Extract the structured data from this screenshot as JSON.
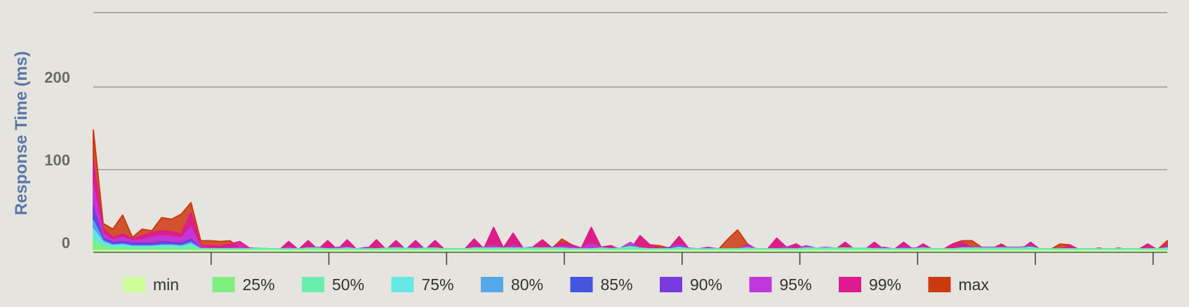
{
  "chart_data": {
    "type": "area",
    "stacking": "overlaid",
    "title": "",
    "xlabel": "",
    "ylabel": "Response Time (ms)",
    "ylim": [
      0,
      290
    ],
    "yticks": [
      0,
      100,
      200
    ],
    "grid": true,
    "legend_position": "bottom",
    "x": [
      0,
      1,
      2,
      3,
      4,
      5,
      6,
      7,
      8,
      9,
      10,
      11,
      12,
      13,
      14,
      15,
      16,
      17,
      18,
      19,
      20,
      21,
      22,
      23,
      24,
      25,
      26,
      27,
      28,
      29,
      30,
      31,
      32,
      33,
      34,
      35,
      36,
      37,
      38,
      39,
      40,
      41,
      42,
      43,
      44,
      45,
      46,
      47,
      48,
      49,
      50,
      51,
      52,
      53,
      54,
      55,
      56,
      57,
      58,
      59,
      60,
      61,
      62,
      63,
      64,
      65,
      66,
      67,
      68,
      69,
      70,
      71,
      72,
      73,
      74,
      75,
      76,
      77,
      78,
      79,
      80,
      81,
      82,
      83,
      84,
      85,
      86,
      87,
      88,
      89,
      90,
      91,
      92,
      93,
      94,
      95,
      96,
      97,
      98,
      99,
      100,
      101,
      102,
      103,
      104,
      105,
      106,
      107,
      108,
      109,
      110
    ],
    "series": [
      {
        "name": "min",
        "color": "#ccff99",
        "values": [
          2,
          2,
          2,
          2,
          2,
          2,
          2,
          2,
          2,
          2,
          2,
          2,
          2,
          2,
          2,
          2,
          2,
          2,
          2,
          2,
          2,
          2,
          2,
          2,
          2,
          2,
          2,
          2,
          2,
          2,
          2,
          2,
          2,
          2,
          2,
          2,
          2,
          2,
          2,
          2,
          2,
          2,
          2,
          2,
          2,
          2,
          2,
          2,
          2,
          2,
          2,
          2,
          2,
          2,
          2,
          2,
          2,
          2,
          2,
          2,
          2,
          2,
          2,
          2,
          2,
          2,
          2,
          2,
          2,
          2,
          2,
          2,
          2,
          2,
          2,
          2,
          2,
          2,
          2,
          2,
          2,
          2,
          2,
          2,
          2,
          2,
          2,
          2,
          2,
          2,
          2,
          2,
          2,
          2,
          2,
          2,
          2,
          2,
          2,
          2,
          2,
          2,
          2,
          2,
          2,
          2,
          2,
          2,
          2,
          2,
          2
        ]
      },
      {
        "name": "25%",
        "color": "#7ff07f",
        "values": [
          12,
          6,
          4,
          4,
          3,
          3,
          3,
          3,
          3,
          3,
          3,
          3,
          3,
          2,
          2,
          2,
          2,
          2,
          2,
          2,
          2,
          2,
          2,
          2,
          2,
          2,
          2,
          2,
          2,
          2,
          2,
          2,
          2,
          2,
          2,
          2,
          2,
          2,
          2,
          2,
          2,
          2,
          2,
          2,
          2,
          2,
          2,
          2,
          2,
          2,
          2,
          2,
          2,
          2,
          2,
          2,
          2,
          2,
          2,
          2,
          2,
          2,
          2,
          2,
          2,
          2,
          2,
          2,
          2,
          2,
          2,
          2,
          2,
          2,
          2,
          2,
          2,
          2,
          2,
          2,
          2,
          2,
          2,
          2,
          2,
          2,
          2,
          2,
          2,
          2,
          2,
          2,
          2,
          2,
          2,
          2,
          2,
          2,
          2,
          2,
          2,
          2,
          2,
          2,
          2,
          2,
          2,
          2,
          2,
          2,
          2
        ]
      },
      {
        "name": "50%",
        "color": "#6aeeb0",
        "values": [
          18,
          9,
          6,
          7,
          6,
          6,
          6,
          7,
          7,
          6,
          8,
          4,
          4,
          4,
          4,
          4,
          4,
          5,
          4,
          4,
          4,
          4,
          5,
          5,
          4,
          4,
          5,
          4,
          4,
          4,
          5,
          5,
          5,
          4,
          5,
          5,
          4,
          4,
          4,
          5,
          5,
          5,
          5,
          5,
          5,
          5,
          5,
          5,
          5,
          4,
          4,
          4,
          5,
          4,
          5,
          6,
          5,
          4,
          4,
          4,
          5,
          4,
          4,
          4,
          4,
          4,
          4,
          5,
          4,
          4,
          4,
          4,
          4,
          5,
          5,
          5,
          5,
          5,
          5,
          5,
          4,
          4,
          4,
          4,
          4,
          5,
          4,
          4,
          4,
          5,
          5,
          5,
          5,
          5,
          5,
          5,
          6,
          4,
          4,
          4,
          4,
          4,
          4,
          4,
          4,
          4,
          4,
          4,
          4,
          4,
          5
        ]
      },
      {
        "name": "75%",
        "color": "#66e8e4",
        "values": [
          28,
          12,
          8,
          9,
          7,
          7,
          7,
          8,
          8,
          7,
          10,
          4,
          4,
          4,
          4,
          4,
          4,
          5,
          4,
          4,
          4,
          4,
          5,
          5,
          4,
          4,
          5,
          4,
          4,
          4,
          5,
          5,
          5,
          4,
          5,
          5,
          4,
          4,
          4,
          5,
          5,
          5,
          5,
          5,
          5,
          5,
          5,
          5,
          5,
          4,
          4,
          4,
          5,
          4,
          5,
          7,
          5,
          4,
          4,
          4,
          6,
          4,
          4,
          4,
          4,
          4,
          4,
          5,
          4,
          4,
          4,
          4,
          4,
          5,
          5,
          5,
          5,
          5,
          5,
          5,
          4,
          4,
          4,
          4,
          4,
          5,
          4,
          4,
          4,
          5,
          5,
          5,
          5,
          5,
          5,
          5,
          6,
          4,
          4,
          4,
          4,
          4,
          4,
          4,
          4,
          4,
          4,
          4,
          4,
          4,
          5
        ]
      },
      {
        "name": "80%",
        "color": "#55a8e8",
        "values": [
          38,
          14,
          9,
          10,
          8,
          8,
          8,
          9,
          9,
          8,
          12,
          4,
          4,
          4,
          4,
          4,
          4,
          5,
          4,
          4,
          4,
          4,
          5,
          5,
          4,
          4,
          5,
          4,
          4,
          4,
          5,
          5,
          5,
          4,
          5,
          5,
          4,
          4,
          4,
          5,
          5,
          5,
          5,
          5,
          5,
          5,
          5,
          5,
          5,
          4,
          4,
          4,
          5,
          4,
          5,
          7,
          5,
          4,
          4,
          4,
          6,
          4,
          4,
          4,
          4,
          4,
          4,
          5,
          4,
          4,
          4,
          4,
          4,
          5,
          5,
          5,
          5,
          5,
          5,
          5,
          4,
          4,
          4,
          4,
          4,
          5,
          4,
          4,
          4,
          5,
          5,
          5,
          5,
          5,
          5,
          5,
          6,
          4,
          4,
          4,
          4,
          4,
          4,
          4,
          4,
          4,
          4,
          4,
          4,
          4,
          5
        ]
      },
      {
        "name": "85%",
        "color": "#4455e0",
        "values": [
          45,
          15,
          10,
          11,
          9,
          9,
          9,
          10,
          10,
          9,
          13,
          4,
          4,
          4,
          4,
          4,
          4,
          5,
          4,
          4,
          4,
          4,
          5,
          5,
          4,
          4,
          5,
          4,
          4,
          4,
          5,
          5,
          5,
          4,
          5,
          5,
          4,
          4,
          4,
          5,
          5,
          5,
          5,
          5,
          5,
          5,
          5,
          5,
          5,
          4,
          4,
          4,
          5,
          4,
          5,
          7,
          5,
          4,
          4,
          5,
          6,
          4,
          4,
          4,
          4,
          4,
          4,
          5,
          4,
          4,
          4,
          4,
          4,
          5,
          5,
          5,
          5,
          5,
          5,
          5,
          4,
          4,
          4,
          4,
          4,
          5,
          4,
          4,
          4,
          5,
          5,
          5,
          5,
          5,
          5,
          5,
          6,
          4,
          4,
          4,
          4,
          4,
          4,
          4,
          4,
          4,
          4,
          4,
          4,
          4,
          5
        ]
      },
      {
        "name": "90%",
        "color": "#7a3ae0",
        "values": [
          55,
          17,
          12,
          13,
          11,
          11,
          11,
          13,
          12,
          11,
          16,
          4,
          4,
          4,
          4,
          4,
          4,
          5,
          4,
          4,
          4,
          4,
          5,
          5,
          4,
          4,
          5,
          4,
          4,
          4,
          5,
          5,
          5,
          4,
          5,
          5,
          4,
          4,
          4,
          5,
          5,
          5,
          5,
          5,
          5,
          5,
          5,
          5,
          5,
          4,
          4,
          4,
          5,
          4,
          5,
          8,
          5,
          4,
          4,
          5,
          7,
          4,
          4,
          4,
          4,
          4,
          4,
          5,
          4,
          4,
          4,
          4,
          4,
          5,
          5,
          5,
          5,
          5,
          5,
          5,
          4,
          4,
          4,
          4,
          4,
          5,
          4,
          4,
          4,
          5,
          5,
          5,
          5,
          5,
          5,
          5,
          7,
          4,
          4,
          4,
          4,
          4,
          4,
          4,
          4,
          4,
          4,
          4,
          4,
          4,
          5
        ]
      },
      {
        "name": "95%",
        "color": "#c038dd",
        "values": [
          80,
          22,
          15,
          18,
          14,
          15,
          18,
          20,
          19,
          17,
          30,
          6,
          5,
          5,
          5,
          6,
          5,
          5,
          4,
          4,
          6,
          4,
          5,
          6,
          4,
          6,
          6,
          4,
          6,
          4,
          5,
          6,
          5,
          6,
          5,
          5,
          4,
          4,
          4,
          6,
          6,
          8,
          5,
          8,
          5,
          6,
          5,
          6,
          7,
          6,
          5,
          10,
          6,
          5,
          5,
          12,
          5,
          4,
          4,
          6,
          9,
          5,
          4,
          6,
          4,
          4,
          4,
          8,
          4,
          4,
          4,
          6,
          4,
          8,
          5,
          6,
          5,
          5,
          5,
          5,
          5,
          6,
          4,
          6,
          5,
          6,
          4,
          4,
          4,
          6,
          6,
          6,
          6,
          6,
          6,
          6,
          8,
          4,
          4,
          4,
          4,
          4,
          4,
          4,
          4,
          4,
          4,
          4,
          4,
          4,
          6
        ]
      },
      {
        "name": "99%",
        "color": "#dd1a90",
        "values": [
          110,
          28,
          18,
          22,
          16,
          20,
          24,
          26,
          25,
          22,
          48,
          8,
          8,
          7,
          10,
          13,
          5,
          4,
          3,
          2,
          13,
          3,
          14,
          3,
          14,
          3,
          15,
          3,
          3,
          15,
          3,
          14,
          3,
          14,
          3,
          14,
          3,
          3,
          3,
          16,
          4,
          30,
          5,
          23,
          5,
          6,
          15,
          5,
          12,
          9,
          5,
          30,
          6,
          8,
          3,
          3,
          20,
          9,
          5,
          5,
          19,
          4,
          4,
          6,
          3,
          3,
          3,
          10,
          3,
          3,
          17,
          6,
          10,
          3,
          3,
          3,
          3,
          12,
          3,
          3,
          12,
          3,
          3,
          12,
          3,
          10,
          3,
          3,
          10,
          12,
          6,
          6,
          4,
          9,
          3,
          3,
          12,
          3,
          3,
          3,
          9,
          3,
          3,
          5,
          3,
          5,
          3,
          3,
          10,
          3,
          10
        ]
      },
      {
        "name": "max",
        "color": "#cc3a10",
        "values": [
          148,
          35,
          28,
          45,
          18,
          28,
          26,
          42,
          40,
          46,
          60,
          14,
          14,
          13,
          14,
          5,
          5,
          4,
          3,
          2,
          13,
          3,
          14,
          3,
          14,
          3,
          15,
          3,
          3,
          15,
          3,
          14,
          3,
          14,
          3,
          14,
          3,
          3,
          3,
          16,
          4,
          30,
          5,
          23,
          5,
          6,
          15,
          5,
          16,
          9,
          5,
          30,
          6,
          8,
          3,
          3,
          20,
          9,
          8,
          5,
          19,
          4,
          4,
          6,
          3,
          16,
          27,
          10,
          3,
          3,
          17,
          6,
          10,
          3,
          3,
          3,
          3,
          12,
          3,
          3,
          12,
          3,
          3,
          12,
          3,
          10,
          3,
          3,
          10,
          14,
          14,
          6,
          4,
          10,
          3,
          3,
          12,
          3,
          3,
          10,
          9,
          3,
          3,
          5,
          3,
          5,
          3,
          3,
          10,
          3,
          14
        ]
      }
    ]
  }
}
